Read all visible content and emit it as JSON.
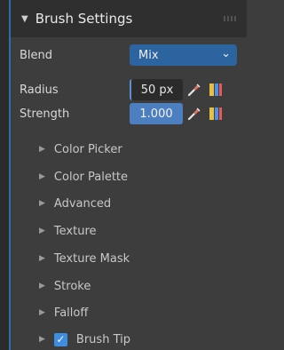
{
  "header": {
    "title": "Brush Settings"
  },
  "blend": {
    "label": "Blend",
    "value": "Mix"
  },
  "radius": {
    "label": "Radius",
    "value": "50 px"
  },
  "strength": {
    "label": "Strength",
    "value": "1.000"
  },
  "subpanels": [
    {
      "label": "Color Picker"
    },
    {
      "label": "Color Palette"
    },
    {
      "label": "Advanced"
    },
    {
      "label": "Texture"
    },
    {
      "label": "Texture Mask"
    },
    {
      "label": "Stroke"
    },
    {
      "label": "Falloff"
    },
    {
      "label": "Brush Tip",
      "checked": true
    }
  ],
  "icons": {
    "expand": "triangle-down",
    "collapsed": "triangle-right",
    "dropdown": "chevron-down",
    "pressure": "pen-icon",
    "palette": "color-swatch-icon",
    "check": "checkmark"
  },
  "colors": {
    "accent": "#2c64a0",
    "field_active": "#4c7fbf"
  }
}
